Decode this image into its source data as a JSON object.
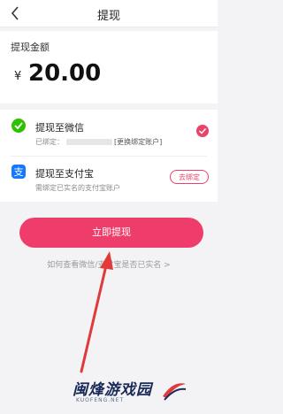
{
  "header": {
    "title": "提现"
  },
  "amount": {
    "label": "提现金额",
    "currency": "¥",
    "value": "20.00"
  },
  "methods": [
    {
      "title": "提现至微信",
      "bound_prefix": "已绑定：",
      "action_link": "[更换绑定账户]",
      "icon": "wechat-icon",
      "selected": true
    },
    {
      "title": "提现至支付宝",
      "subtitle": "需绑定已实名的支付宝账户",
      "action_button": "去绑定",
      "icon": "alipay-icon",
      "selected": false
    }
  ],
  "withdraw_button": "立即提现",
  "help_link": "如何查看微信/支付宝是否已实名 >",
  "watermark": {
    "text": "闽烽游戏园",
    "sub": "KUOFENG.NET"
  },
  "colors": {
    "accent": "#ef3d6b",
    "wechat": "#2dc100",
    "alipay": "#1677ff",
    "annotation_arrow": "#e23a3a"
  }
}
